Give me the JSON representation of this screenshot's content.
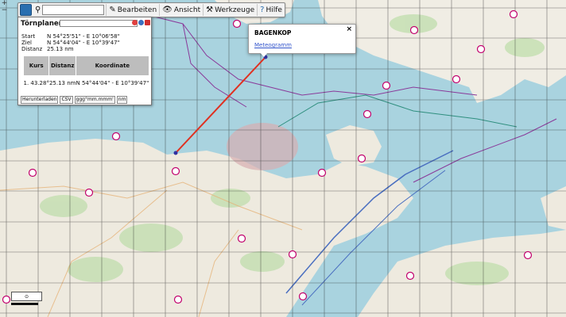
{
  "toolbar": {
    "search_placeholder": "",
    "buttons": [
      "Bearbeiten",
      "Ansicht",
      "Werkzeuge",
      "Hilfe"
    ]
  },
  "zoom": {
    "plus": "+",
    "minus": "−"
  },
  "route_panel": {
    "title": "Törnplaner:",
    "name_value": "",
    "start_label": "Start",
    "start_value": "N 54°25'51\" - E 10°06'58\"",
    "ziel_label": "Ziel",
    "ziel_value": "N 54°44'04\" - E 10°39'47\"",
    "distanz_label": "Distanz",
    "distanz_value": "25.13 nm",
    "table": {
      "headers": [
        "Kurs",
        "Distanz",
        "Koordinate"
      ],
      "row": [
        "1. 43.28°",
        "25.13 nm",
        "N 54°44'04\" - E 10°39'47\""
      ]
    },
    "download_label": "Herunterladen",
    "format_option": "CSV",
    "coord_format_option": "ggg°mm.mmm'",
    "unit_option": "nm"
  },
  "popup": {
    "title": "BAGENKOP",
    "link": "Meteogramm",
    "close": "×"
  },
  "colors": {
    "sea": "#a9d3df",
    "land": "#f2efe9",
    "route": "#e03020",
    "harbour": "#c2006d",
    "grid": "#1a1a1a"
  }
}
